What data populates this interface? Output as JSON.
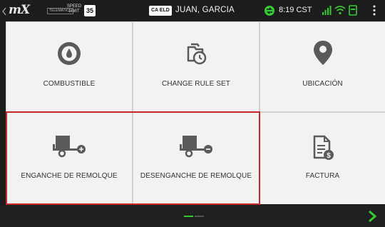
{
  "header": {
    "logo_text": "mX",
    "telematics_label": "TELEMATICS",
    "speed_limit_label": "SPEED LIMIT",
    "speed_limit_value": "35",
    "eld_badge": "CA ELD",
    "driver_name": "JUAN, GARCIA",
    "time": "8:19 CST"
  },
  "tiles": [
    {
      "label": "COMBUSTIBLE",
      "icon": "fuel-drop-icon"
    },
    {
      "label": "CHANGE RULE SET",
      "icon": "rule-set-clock-icon"
    },
    {
      "label": "UBICACIÓN",
      "icon": "location-pin-icon"
    },
    {
      "label": "ENGANCHE DE REMOLQUE",
      "icon": "trailer-hook-icon"
    },
    {
      "label": "DESENGANCHE DE REMOLQUE",
      "icon": "trailer-unhook-icon"
    },
    {
      "label": "FACTURA",
      "icon": "invoice-icon"
    }
  ],
  "colors": {
    "icon_gray": "#5a5a5a",
    "selection_border": "#c62828",
    "status_green": "#33cc33"
  },
  "pager": {
    "current_page": 1,
    "total_pages": 2
  }
}
